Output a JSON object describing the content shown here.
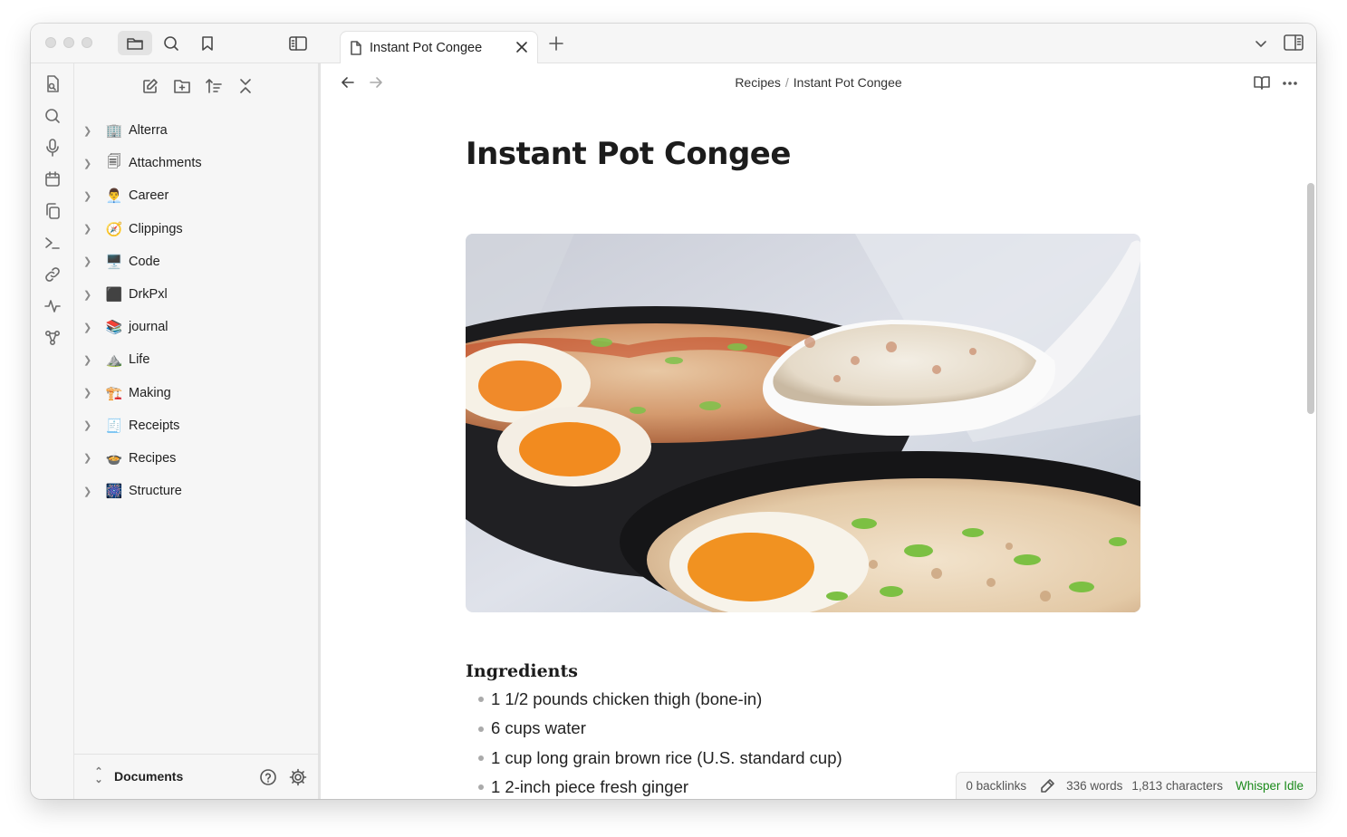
{
  "window": {
    "accent": "#1a8a1a"
  },
  "tab": {
    "title": "Instant Pot Congee"
  },
  "breadcrumb": {
    "parent": "Recipes",
    "separator": "/",
    "current": "Instant Pot Congee"
  },
  "sidebar": {
    "items": [
      {
        "emoji": "🏢",
        "label": "Alterra"
      },
      {
        "emoji": "🗐",
        "label": "Attachments"
      },
      {
        "emoji": "👨‍💼",
        "label": "Career"
      },
      {
        "emoji": "🧭",
        "label": "Clippings"
      },
      {
        "emoji": "🖥️",
        "label": "Code"
      },
      {
        "emoji": "⬛",
        "label": "DrkPxl"
      },
      {
        "emoji": "📚",
        "label": "journal"
      },
      {
        "emoji": "⛰️",
        "label": "Life"
      },
      {
        "emoji": "🏗️",
        "label": "Making"
      },
      {
        "emoji": "🧾",
        "label": "Receipts"
      },
      {
        "emoji": "🍲",
        "label": "Recipes"
      },
      {
        "emoji": "🎆",
        "label": "Structure"
      }
    ],
    "vault": "Documents"
  },
  "note": {
    "title": "Instant Pot Congee",
    "section": "Ingredients",
    "ingredients": [
      "1 1/2 pounds chicken thigh (bone-in)",
      "6 cups water",
      "1 cup long grain brown rice (U.S. standard cup)",
      "1 2-inch piece fresh ginger"
    ]
  },
  "status": {
    "backlinks": "0 backlinks",
    "words": "336 words",
    "characters": "1,813 characters",
    "plugin": "Whisper Idle"
  }
}
